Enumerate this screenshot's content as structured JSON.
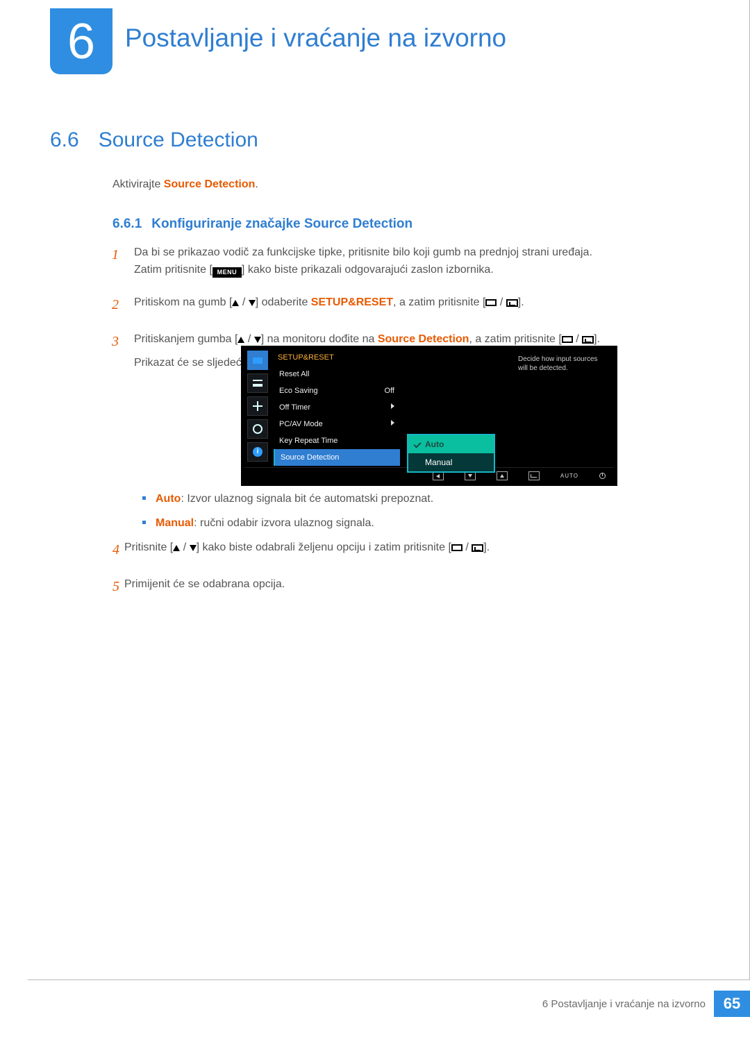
{
  "chapter": {
    "number": "6",
    "title": "Postavljanje i vraćanje na izvorno"
  },
  "section": {
    "number": "6.6",
    "title": "Source Detection"
  },
  "intro": {
    "prefix": "Aktivirajte ",
    "bold": "Source Detection",
    "suffix": "."
  },
  "subsection": {
    "number": "6.6.1",
    "title": "Konfiguriranje značajke Source Detection"
  },
  "steps": {
    "s1": {
      "num": "1",
      "line1": "Da bi se prikazao vodič za funkcijske tipke, pritisnite bilo koji gumb na prednjoj strani uređaja.",
      "line2a": "Zatim pritisnite [",
      "menu": "MENU",
      "line2b": "] kako biste prikazali odgovarajući zaslon izbornika."
    },
    "s2": {
      "num": "2",
      "a": "Pritiskom na gumb [",
      "b": "] odaberite ",
      "hl": "SETUP&RESET",
      "c": ", a zatim pritisnite [",
      "d": "]."
    },
    "s3": {
      "num": "3",
      "a": "Pritiskanjem gumba [",
      "b": "] na monitoru dođite na ",
      "hl": "Source Detection",
      "c": ", a zatim pritisnite [",
      "d": "].",
      "after": "Prikazat će se sljedeći zaslon."
    },
    "s4": {
      "num": "4",
      "a": "Pritisnite [",
      "b": "] kako biste odabrali željenu opciju i zatim pritisnite [",
      "c": "]."
    },
    "s5": {
      "num": "5",
      "text": "Primijenit će se odabrana opcija."
    }
  },
  "osd": {
    "header": "SETUP&RESET",
    "hint": "Decide how input sources will be detected.",
    "rows": {
      "reset": "Reset All",
      "eco": "Eco Saving",
      "eco_val": "Off",
      "offtimer": "Off Timer",
      "pcav": "PC/AV Mode",
      "keyrepeat": "Key Repeat Time",
      "srcdet": "Source Detection"
    },
    "popup": {
      "auto": "Auto",
      "manual": "Manual"
    },
    "bar": {
      "auto": "AUTO"
    }
  },
  "bullets": {
    "auto_label": "Auto",
    "auto_text": ": Izvor ulaznog signala bit će automatski prepoznat.",
    "manual_label": "Manual",
    "manual_text": ": ručni odabir izvora ulaznog signala."
  },
  "footer": {
    "text": "6 Postavljanje i vraćanje na izvorno",
    "page": "65"
  }
}
